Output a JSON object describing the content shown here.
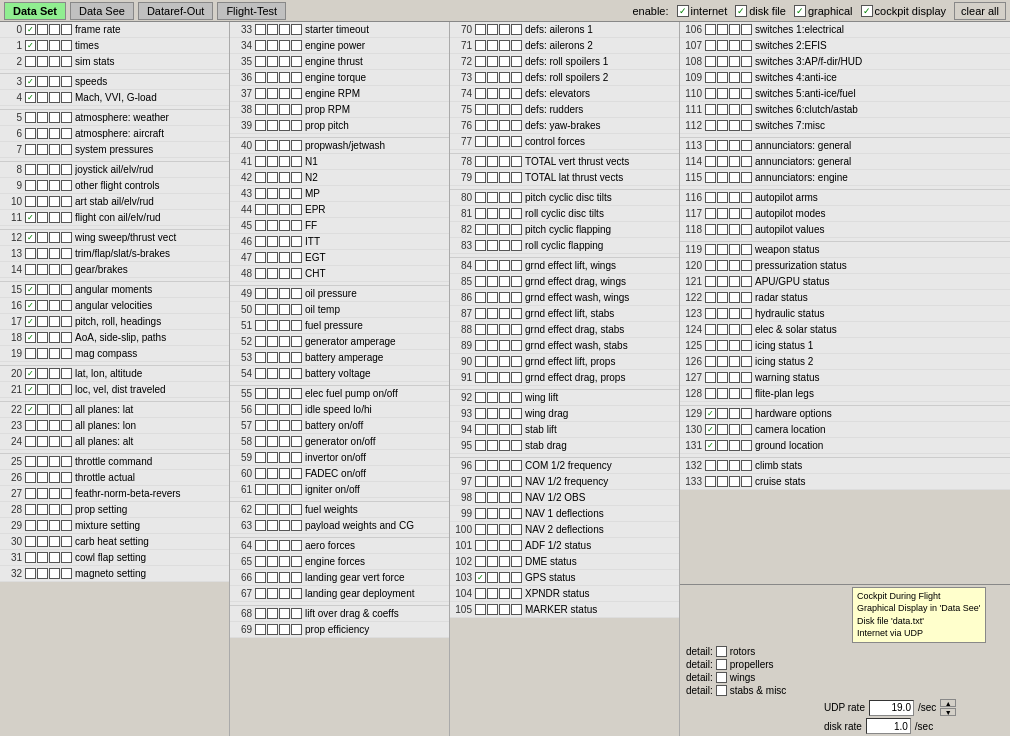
{
  "tabs": [
    {
      "label": "Data Set",
      "active": true
    },
    {
      "label": "Data See",
      "active": false
    },
    {
      "label": "Dataref-Out",
      "active": false
    },
    {
      "label": "Flight-Test",
      "active": false
    }
  ],
  "enable": {
    "label": "enable:",
    "items": [
      {
        "label": "internet",
        "checked": true
      },
      {
        "label": "disk file",
        "checked": true
      },
      {
        "label": "graphical",
        "checked": true
      },
      {
        "label": "cockpit display",
        "checked": true
      }
    ]
  },
  "clear_all": "clear all",
  "rows": [
    {
      "num": "0",
      "checked": true,
      "label": "frame rate"
    },
    {
      "num": "1",
      "checked": true,
      "label": "times"
    },
    {
      "num": "2",
      "checked": false,
      "label": "sim stats"
    },
    {
      "num": "",
      "checked": false,
      "label": ""
    },
    {
      "num": "3",
      "checked": true,
      "label": "speeds"
    },
    {
      "num": "4",
      "checked": true,
      "label": "Mach, VVI, G-load"
    },
    {
      "num": "",
      "checked": false,
      "label": ""
    },
    {
      "num": "5",
      "checked": false,
      "label": "atmosphere: weather"
    },
    {
      "num": "6",
      "checked": false,
      "label": "atmosphere: aircraft"
    },
    {
      "num": "7",
      "checked": false,
      "label": "system pressures"
    },
    {
      "num": "",
      "checked": false,
      "label": ""
    },
    {
      "num": "8",
      "checked": false,
      "label": "joystick ail/elv/rud"
    },
    {
      "num": "9",
      "checked": false,
      "label": "other flight controls"
    },
    {
      "num": "10",
      "checked": false,
      "label": "art stab ail/elv/rud"
    },
    {
      "num": "11",
      "checked": true,
      "label": "flight con ail/elv/rud"
    },
    {
      "num": "",
      "checked": false,
      "label": ""
    },
    {
      "num": "12",
      "checked": true,
      "label": "wing sweep/thrust vect"
    },
    {
      "num": "13",
      "checked": false,
      "label": "trim/flap/slat/s-brakes"
    },
    {
      "num": "14",
      "checked": false,
      "label": "gear/brakes"
    },
    {
      "num": "",
      "checked": false,
      "label": ""
    },
    {
      "num": "15",
      "checked": true,
      "label": "angular moments"
    },
    {
      "num": "16",
      "checked": true,
      "label": "angular velocities"
    },
    {
      "num": "17",
      "checked": true,
      "label": "pitch, roll, headings"
    },
    {
      "num": "18",
      "checked": true,
      "label": "AoA, side-slip, paths"
    },
    {
      "num": "19",
      "checked": false,
      "label": "mag compass"
    },
    {
      "num": "",
      "checked": false,
      "label": ""
    },
    {
      "num": "20",
      "checked": true,
      "label": "lat, lon, altitude"
    },
    {
      "num": "21",
      "checked": true,
      "label": "loc, vel, dist traveled"
    },
    {
      "num": "",
      "checked": false,
      "label": ""
    },
    {
      "num": "22",
      "checked": true,
      "label": "all planes: lat"
    },
    {
      "num": "23",
      "checked": false,
      "label": "all planes: lon"
    },
    {
      "num": "24",
      "checked": false,
      "label": "all planes: alt"
    },
    {
      "num": "",
      "checked": false,
      "label": ""
    },
    {
      "num": "25",
      "checked": false,
      "label": "throttle command"
    },
    {
      "num": "26",
      "checked": false,
      "label": "throttle actual"
    },
    {
      "num": "27",
      "checked": false,
      "label": "feathr-norm-beta-revers"
    },
    {
      "num": "28",
      "checked": false,
      "label": "prop setting"
    },
    {
      "num": "29",
      "checked": false,
      "label": "mixture setting"
    },
    {
      "num": "30",
      "checked": false,
      "label": "carb heat setting"
    },
    {
      "num": "31",
      "checked": false,
      "label": "cowl flap setting"
    },
    {
      "num": "32",
      "checked": false,
      "label": "magneto setting"
    }
  ],
  "rows2": [
    {
      "num": "33",
      "checked": false,
      "label": "starter timeout"
    },
    {
      "num": "34",
      "checked": false,
      "label": "engine power"
    },
    {
      "num": "35",
      "checked": false,
      "label": "engine thrust"
    },
    {
      "num": "36",
      "checked": false,
      "label": "engine torque"
    },
    {
      "num": "37",
      "checked": false,
      "label": "engine RPM"
    },
    {
      "num": "38",
      "checked": false,
      "label": "prop RPM"
    },
    {
      "num": "39",
      "checked": false,
      "label": "prop pitch"
    },
    {
      "num": "",
      "checked": false,
      "label": ""
    },
    {
      "num": "40",
      "checked": false,
      "label": "propwash/jetwash"
    },
    {
      "num": "41",
      "checked": false,
      "label": "N1"
    },
    {
      "num": "42",
      "checked": false,
      "label": "N2"
    },
    {
      "num": "43",
      "checked": false,
      "label": "MP"
    },
    {
      "num": "44",
      "checked": false,
      "label": "EPR"
    },
    {
      "num": "45",
      "checked": false,
      "label": "FF"
    },
    {
      "num": "46",
      "checked": false,
      "label": "ITT"
    },
    {
      "num": "47",
      "checked": false,
      "label": "EGT"
    },
    {
      "num": "48",
      "checked": false,
      "label": "CHT"
    },
    {
      "num": "",
      "checked": false,
      "label": ""
    },
    {
      "num": "49",
      "checked": false,
      "label": "oil pressure"
    },
    {
      "num": "50",
      "checked": false,
      "label": "oil temp"
    },
    {
      "num": "51",
      "checked": false,
      "label": "fuel pressure"
    },
    {
      "num": "52",
      "checked": false,
      "label": "generator amperage"
    },
    {
      "num": "53",
      "checked": false,
      "label": "battery amperage"
    },
    {
      "num": "54",
      "checked": false,
      "label": "battery voltage"
    },
    {
      "num": "",
      "checked": false,
      "label": ""
    },
    {
      "num": "55",
      "checked": false,
      "label": "elec fuel pump on/off"
    },
    {
      "num": "56",
      "checked": false,
      "label": "idle speed lo/hi"
    },
    {
      "num": "57",
      "checked": false,
      "label": "battery on/off"
    },
    {
      "num": "58",
      "checked": false,
      "label": "generator on/off"
    },
    {
      "num": "59",
      "checked": false,
      "label": "invertor on/off"
    },
    {
      "num": "60",
      "checked": false,
      "label": "FADEC on/off"
    },
    {
      "num": "61",
      "checked": false,
      "label": "igniter on/off"
    },
    {
      "num": "",
      "checked": false,
      "label": ""
    },
    {
      "num": "62",
      "checked": false,
      "label": "fuel weights"
    },
    {
      "num": "63",
      "checked": false,
      "label": "payload weights and CG"
    },
    {
      "num": "",
      "checked": false,
      "label": ""
    },
    {
      "num": "64",
      "checked": false,
      "label": "aero forces"
    },
    {
      "num": "65",
      "checked": false,
      "label": "engine forces"
    },
    {
      "num": "66",
      "checked": false,
      "label": "landing gear vert force"
    },
    {
      "num": "67",
      "checked": false,
      "label": "landing gear deployment"
    },
    {
      "num": "",
      "checked": false,
      "label": ""
    },
    {
      "num": "68",
      "checked": false,
      "label": "lift over drag & coeffs"
    },
    {
      "num": "69",
      "checked": false,
      "label": "prop efficiency"
    }
  ],
  "rows3": [
    {
      "num": "70",
      "checked": false,
      "label": "defs: ailerons 1"
    },
    {
      "num": "71",
      "checked": false,
      "label": "defs: ailerons 2"
    },
    {
      "num": "72",
      "checked": false,
      "label": "defs: roll spoilers 1"
    },
    {
      "num": "73",
      "checked": false,
      "label": "defs: roll spoilers 2"
    },
    {
      "num": "74",
      "checked": false,
      "label": "defs: elevators"
    },
    {
      "num": "75",
      "checked": false,
      "label": "defs: rudders"
    },
    {
      "num": "76",
      "checked": false,
      "label": "defs: yaw-brakes"
    },
    {
      "num": "77",
      "checked": false,
      "label": "control forces"
    },
    {
      "num": "",
      "checked": false,
      "label": ""
    },
    {
      "num": "78",
      "checked": false,
      "label": "TOTAL vert thrust vects"
    },
    {
      "num": "79",
      "checked": false,
      "label": "TOTAL lat  thrust vects"
    },
    {
      "num": "",
      "checked": false,
      "label": ""
    },
    {
      "num": "80",
      "checked": false,
      "label": "pitch cyclic disc tilts"
    },
    {
      "num": "81",
      "checked": false,
      "label": "roll cyclic disc tilts"
    },
    {
      "num": "82",
      "checked": false,
      "label": "pitch cyclic flapping"
    },
    {
      "num": "83",
      "checked": false,
      "label": "roll cyclic flapping"
    },
    {
      "num": "",
      "checked": false,
      "label": ""
    },
    {
      "num": "84",
      "checked": false,
      "label": "grnd effect lift, wings"
    },
    {
      "num": "85",
      "checked": false,
      "label": "grnd effect drag, wings"
    },
    {
      "num": "86",
      "checked": false,
      "label": "grnd effect wash, wings"
    },
    {
      "num": "87",
      "checked": false,
      "label": "grnd effect lift, stabs"
    },
    {
      "num": "88",
      "checked": false,
      "label": "grnd effect drag, stabs"
    },
    {
      "num": "89",
      "checked": false,
      "label": "grnd effect wash, stabs"
    },
    {
      "num": "90",
      "checked": false,
      "label": "grnd effect lift, props"
    },
    {
      "num": "91",
      "checked": false,
      "label": "grnd effect drag, props"
    },
    {
      "num": "",
      "checked": false,
      "label": ""
    },
    {
      "num": "92",
      "checked": false,
      "label": "wing lift"
    },
    {
      "num": "93",
      "checked": false,
      "label": "wing drag"
    },
    {
      "num": "94",
      "checked": false,
      "label": "stab lift"
    },
    {
      "num": "95",
      "checked": false,
      "label": "stab drag"
    },
    {
      "num": "",
      "checked": false,
      "label": ""
    },
    {
      "num": "96",
      "checked": false,
      "label": "COM 1/2 frequency"
    },
    {
      "num": "97",
      "checked": false,
      "label": "NAV 1/2 frequency"
    },
    {
      "num": "98",
      "checked": false,
      "label": "NAV 1/2 OBS"
    },
    {
      "num": "99",
      "checked": false,
      "label": "NAV 1 deflections"
    },
    {
      "num": "100",
      "checked": false,
      "label": "NAV 2 deflections"
    },
    {
      "num": "101",
      "checked": false,
      "label": "ADF 1/2 status"
    },
    {
      "num": "102",
      "checked": false,
      "label": "DME status"
    },
    {
      "num": "103",
      "checked": true,
      "label": "GPS status"
    },
    {
      "num": "104",
      "checked": false,
      "label": "XPNDR status"
    },
    {
      "num": "105",
      "checked": false,
      "label": "MARKER status"
    }
  ],
  "rows4": [
    {
      "num": "106",
      "checked": false,
      "label": "switches 1:electrical"
    },
    {
      "num": "107",
      "checked": false,
      "label": "switches 2:EFIS"
    },
    {
      "num": "108",
      "checked": false,
      "label": "switches 3:AP/f-dir/HUD"
    },
    {
      "num": "109",
      "checked": false,
      "label": "switches 4:anti-ice"
    },
    {
      "num": "110",
      "checked": false,
      "label": "switches 5:anti-ice/fuel"
    },
    {
      "num": "111",
      "checked": false,
      "label": "switches 6:clutch/astab"
    },
    {
      "num": "112",
      "checked": false,
      "label": "switches 7:misc"
    },
    {
      "num": "",
      "checked": false,
      "label": ""
    },
    {
      "num": "113",
      "checked": false,
      "label": "annunciators: general"
    },
    {
      "num": "114",
      "checked": false,
      "label": "annunciators: general"
    },
    {
      "num": "115",
      "checked": false,
      "label": "annunciators: engine"
    },
    {
      "num": "",
      "checked": false,
      "label": ""
    },
    {
      "num": "116",
      "checked": false,
      "label": "autopilot arms"
    },
    {
      "num": "117",
      "checked": false,
      "label": "autopilot modes"
    },
    {
      "num": "118",
      "checked": false,
      "label": "autopilot values"
    },
    {
      "num": "",
      "checked": false,
      "label": ""
    },
    {
      "num": "119",
      "checked": false,
      "label": "weapon status"
    },
    {
      "num": "120",
      "checked": false,
      "label": "pressurization status"
    },
    {
      "num": "121",
      "checked": false,
      "label": "APU/GPU status"
    },
    {
      "num": "122",
      "checked": false,
      "label": "radar status"
    },
    {
      "num": "123",
      "checked": false,
      "label": "hydraulic status"
    },
    {
      "num": "124",
      "checked": false,
      "label": "elec & solar status"
    },
    {
      "num": "125",
      "checked": false,
      "label": "icing status 1"
    },
    {
      "num": "126",
      "checked": false,
      "label": "icing status 2"
    },
    {
      "num": "127",
      "checked": false,
      "label": "warning status"
    },
    {
      "num": "128",
      "checked": false,
      "label": "flite-plan legs"
    },
    {
      "num": "",
      "checked": false,
      "label": ""
    },
    {
      "num": "129",
      "checked": true,
      "label": "hardware options"
    },
    {
      "num": "130",
      "checked": true,
      "label": "camera location"
    },
    {
      "num": "131",
      "checked": true,
      "label": "ground location"
    },
    {
      "num": "",
      "checked": false,
      "label": ""
    },
    {
      "num": "132",
      "checked": false,
      "label": "climb stats"
    },
    {
      "num": "133",
      "checked": false,
      "label": "cruise stats"
    }
  ],
  "detail_rows": [
    {
      "label": "detail:",
      "cb_label": "rotors"
    },
    {
      "label": "detail:",
      "cb_label": "propellers"
    },
    {
      "label": "detail:",
      "cb_label": "wings"
    },
    {
      "label": "detail:",
      "cb_label": "stabs & misc"
    }
  ],
  "tooltip": {
    "line1": "Cockpit During Flight",
    "line2": "Graphical Display in 'Data See'",
    "line3": "Disk file 'data.txt'",
    "line4": "Internet via UDP"
  },
  "udp_rate_label": "UDP rate",
  "udp_rate_value": "19.0",
  "per_sec": "/sec",
  "disk_rate_label": "disk rate",
  "disk_rate_value": "1.0"
}
